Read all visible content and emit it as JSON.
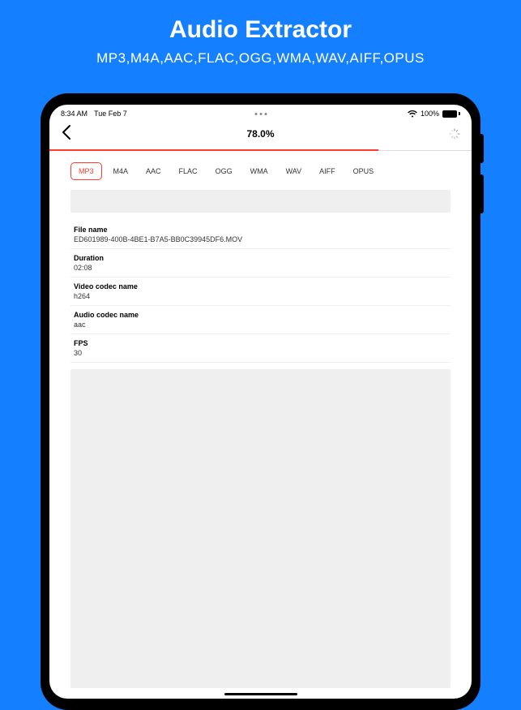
{
  "promo": {
    "title": "Audio Extractor",
    "subtitle": "MP3,M4A,AAC,FLAC,OGG,WMA,WAV,AIFF,OPUS"
  },
  "status": {
    "time": "8:34 AM",
    "date": "Tue Feb 7",
    "battery": "100%"
  },
  "nav": {
    "progress_label": "78.0%",
    "progress_value": 78
  },
  "tabs": [
    "MP3",
    "M4A",
    "AAC",
    "FLAC",
    "OGG",
    "WMA",
    "WAV",
    "AIFF",
    "OPUS"
  ],
  "selected_tab": 0,
  "info": {
    "file_name_label": "File name",
    "file_name_value": "ED601989-400B-4BE1-B7A5-BB0C39945DF6.MOV",
    "duration_label": "Duration",
    "duration_value": "02:08",
    "video_codec_label": "Video codec name",
    "video_codec_value": "h264",
    "audio_codec_label": "Audio codec name",
    "audio_codec_value": "aac",
    "fps_label": "FPS",
    "fps_value": "30"
  }
}
